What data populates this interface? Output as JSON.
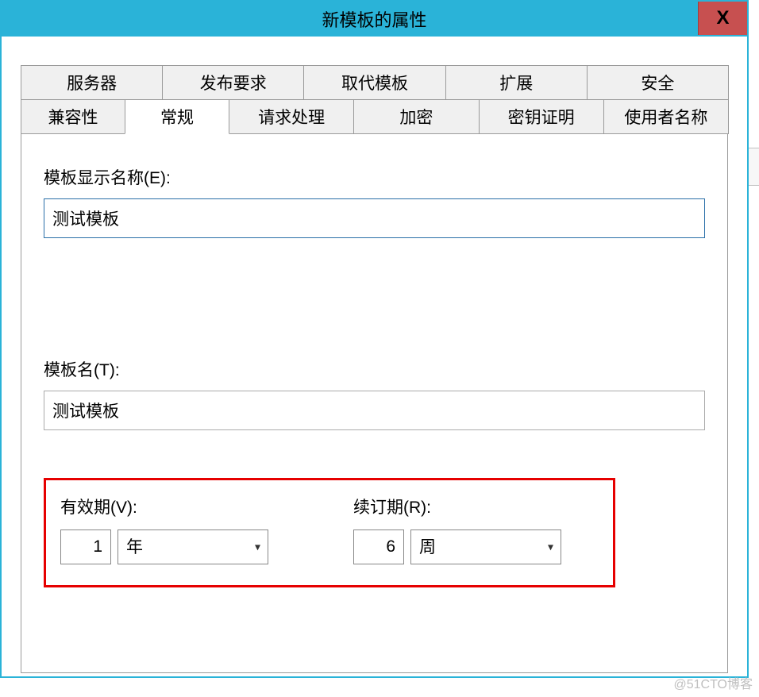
{
  "window": {
    "title": "新模板的属性",
    "close_label": "X"
  },
  "tabs_row1": {
    "server": "服务器",
    "publish": "发布要求",
    "supersede": "取代模板",
    "extensions": "扩展",
    "security": "安全"
  },
  "tabs_row2": {
    "compat": "兼容性",
    "general": "常规",
    "request": "请求处理",
    "crypto": "加密",
    "key_attest": "密钥证明",
    "subject": "使用者名称"
  },
  "general": {
    "display_name_label": "模板显示名称(E):",
    "display_name_value": "测试模板",
    "template_name_label": "模板名(T):",
    "template_name_value": "测试模板",
    "validity_label": "有效期(V):",
    "validity_value": "1",
    "validity_unit": "年",
    "renewal_label": "续订期(R):",
    "renewal_value": "6",
    "renewal_unit": "周"
  },
  "watermark": "@51CTO博客"
}
